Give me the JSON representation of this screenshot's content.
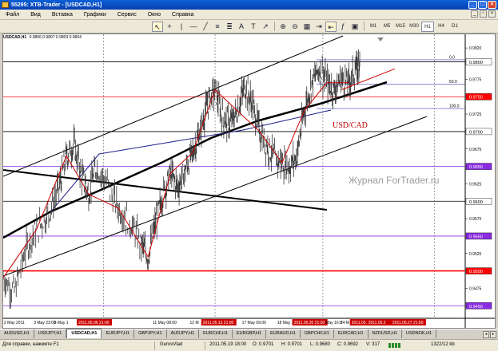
{
  "window": {
    "title": "55295: XTB-Trader - [USDCAD,H1]",
    "controls": [
      "_",
      "□",
      "×"
    ]
  },
  "menu": {
    "items": [
      "Файл",
      "Вид",
      "Вставка",
      "Графики",
      "Сервис",
      "Окно",
      "Справка"
    ]
  },
  "toolbar": {
    "timeframes": [
      "M1",
      "M5",
      "M15",
      "M30",
      "H1",
      "H4",
      "D1"
    ],
    "active_timeframe": "H1"
  },
  "chart": {
    "symbol_header": {
      "symbol": "USDCAD,H1",
      "values": "0.9806 0.9807 0.9803 0.9804"
    },
    "pair_label": "USD/CAD",
    "watermark": "Журнал ForTrader.ru",
    "price_labels": [
      {
        "text": "0.9800",
        "y": 0.98,
        "bg": "#ffffff",
        "fg": "#000000"
      },
      {
        "text": "0.9750",
        "y": 0.975,
        "bg": "#ff0000",
        "fg": "#ffffff"
      },
      {
        "text": "0.9700",
        "y": 0.97,
        "bg": "#ffffff",
        "fg": "#000000"
      },
      {
        "text": "0.9650",
        "y": 0.965,
        "bg": "#8a2be2",
        "fg": "#ffffff"
      },
      {
        "text": "0.9600",
        "y": 0.96,
        "bg": "#ffffff",
        "fg": "#000000"
      },
      {
        "text": "0.9550",
        "y": 0.955,
        "bg": "#8a2be2",
        "fg": "#ffffff"
      },
      {
        "text": "0.9500",
        "y": 0.95,
        "bg": "#ff0000",
        "fg": "#ffffff"
      },
      {
        "text": "0.9450",
        "y": 0.945,
        "bg": "#8a2be2",
        "fg": "#ffffff"
      }
    ],
    "axis_labels": [
      {
        "text": "0.9820",
        "y": 0.982
      },
      {
        "text": "0.9775",
        "y": 0.9775
      },
      {
        "text": "0.9725",
        "y": 0.9725
      },
      {
        "text": "0.9675",
        "y": 0.9675
      },
      {
        "text": "0.9625",
        "y": 0.9625
      },
      {
        "text": "0.9575",
        "y": 0.9575
      },
      {
        "text": "0.9525",
        "y": 0.9525
      },
      {
        "text": "0.9475",
        "y": 0.9475
      }
    ],
    "fib_levels": [
      {
        "text": "0.0",
        "y": 0.9803
      },
      {
        "text": "50.0",
        "y": 0.9768
      },
      {
        "text": "100.0",
        "y": 0.9733
      }
    ],
    "time_labels": [
      {
        "text": "2 May 2011",
        "x": 0.0,
        "hl": false
      },
      {
        "text": "3 May 23:00",
        "x": 0.08,
        "hl": false
      },
      {
        "text": "5 May 1",
        "x": 0.135,
        "hl": false
      },
      {
        "text": "2011.05.06 21:00",
        "x": 0.2,
        "hl": true
      },
      {
        "text": "11 May 08:00",
        "x": 0.4,
        "hl": false
      },
      {
        "text": "12 M",
        "x": 0.5,
        "hl": false
      },
      {
        "text": "2011.05.13 21:00",
        "x": 0.535,
        "hl": true
      },
      {
        "text": "17 May 09:00",
        "x": 0.64,
        "hl": false
      },
      {
        "text": "18 May 17:00",
        "x": 0.735,
        "hl": false
      },
      {
        "text": "2011.05.20 21:00",
        "x": 0.78,
        "hl": true
      },
      {
        "text": "May 16:0",
        "x": 0.865,
        "hl": false
      },
      {
        "text": "24 M",
        "x": 0.905,
        "hl": false
      },
      {
        "text": "2011.05.2",
        "x": 0.935,
        "hl": true
      },
      {
        "text": "2011.05.2",
        "x": 0.98,
        "hl": true
      },
      {
        "text": "2011.05.27 21:00",
        "x": 1.045,
        "hl": true
      }
    ],
    "series": {
      "knots": [
        [
          0,
          0.949
        ],
        [
          0.03,
          0.947
        ],
        [
          0.06,
          0.953
        ],
        [
          0.09,
          0.956
        ],
        [
          0.12,
          0.958
        ],
        [
          0.15,
          0.962
        ],
        [
          0.17,
          0.9665
        ],
        [
          0.19,
          0.968
        ],
        [
          0.21,
          0.964
        ],
        [
          0.23,
          0.961
        ],
        [
          0.25,
          0.965
        ],
        [
          0.28,
          0.9625
        ],
        [
          0.31,
          0.959
        ],
        [
          0.34,
          0.957
        ],
        [
          0.37,
          0.954
        ],
        [
          0.39,
          0.952
        ],
        [
          0.41,
          0.957
        ],
        [
          0.43,
          0.961
        ],
        [
          0.45,
          0.964
        ],
        [
          0.47,
          0.962
        ],
        [
          0.49,
          0.9645
        ],
        [
          0.51,
          0.967
        ],
        [
          0.53,
          0.97
        ],
        [
          0.55,
          0.974
        ],
        [
          0.57,
          0.976
        ],
        [
          0.59,
          0.972
        ],
        [
          0.61,
          0.971
        ],
        [
          0.63,
          0.973
        ],
        [
          0.65,
          0.9765
        ],
        [
          0.67,
          0.974
        ],
        [
          0.69,
          0.97
        ],
        [
          0.71,
          0.968
        ],
        [
          0.73,
          0.966
        ],
        [
          0.75,
          0.9655
        ],
        [
          0.77,
          0.965
        ],
        [
          0.79,
          0.9665
        ],
        [
          0.81,
          0.973
        ],
        [
          0.83,
          0.977
        ],
        [
          0.85,
          0.979
        ],
        [
          0.87,
          0.977
        ],
        [
          0.89,
          0.976
        ],
        [
          0.91,
          0.9775
        ],
        [
          0.93,
          0.977
        ],
        [
          0.95,
          0.979
        ],
        [
          0.96,
          0.9803
        ]
      ]
    },
    "colors": {
      "level_red": "#ff0000",
      "level_purple": "#8a2be2",
      "zigzag": "#cc0000",
      "channel": "#000000",
      "ma_line": "#1b1b8a"
    }
  },
  "tabs": {
    "items": [
      "AUDUSD,H1",
      "USDJPY,H1",
      "USDCAD,H1",
      "EURJPY,H1",
      "GBPJPY,H1",
      "AUDJPY,H1",
      "EURCHF,H1",
      "EURGBP,H1",
      "EURAUD,H1",
      "GBPCHF,H1",
      "EURCAD,H1",
      "NZDUSD,H1",
      "USDNOK,H1"
    ],
    "active": "USDCAD,H1"
  },
  "status": {
    "help": "Для справки, нажмите F1",
    "profile": "GurovVlad",
    "time": "2011.05.19 18:00",
    "open": "O: 0.9701",
    "high": "H: 0.9701",
    "low": "L: 0.9680",
    "close": "C: 0.9692",
    "volume": "V: 317",
    "traffic": "1322/12 kb"
  }
}
